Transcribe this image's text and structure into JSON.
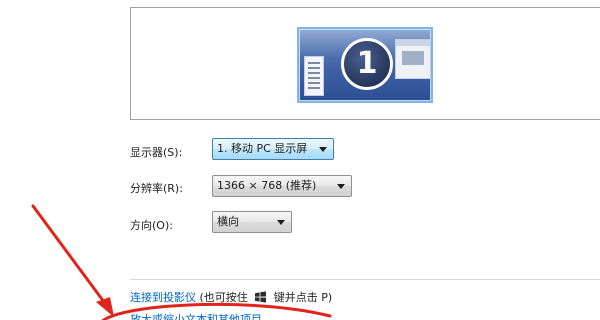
{
  "preview": {
    "monitor_number": "1"
  },
  "settings": {
    "display": {
      "label": "显示器(S):",
      "value": "1. 移动 PC 显示屏"
    },
    "resolution": {
      "label": "分辨率(R):",
      "value": "1366 × 768 (推荐)"
    },
    "orientation": {
      "label": "方向(O):",
      "value": "横向"
    }
  },
  "projector": {
    "link_text": "连接到投影仪",
    "hint_prefix": "(也可按住",
    "hint_suffix": "键并点击 P)"
  },
  "bottom_link": "放大或缩小文本和其他项目",
  "icons": {
    "windows_key": "windows-logo-icon"
  },
  "colors": {
    "link": "#0066cc",
    "annotation": "#e0241b",
    "focused_dropdown": "#3c7fb1"
  }
}
